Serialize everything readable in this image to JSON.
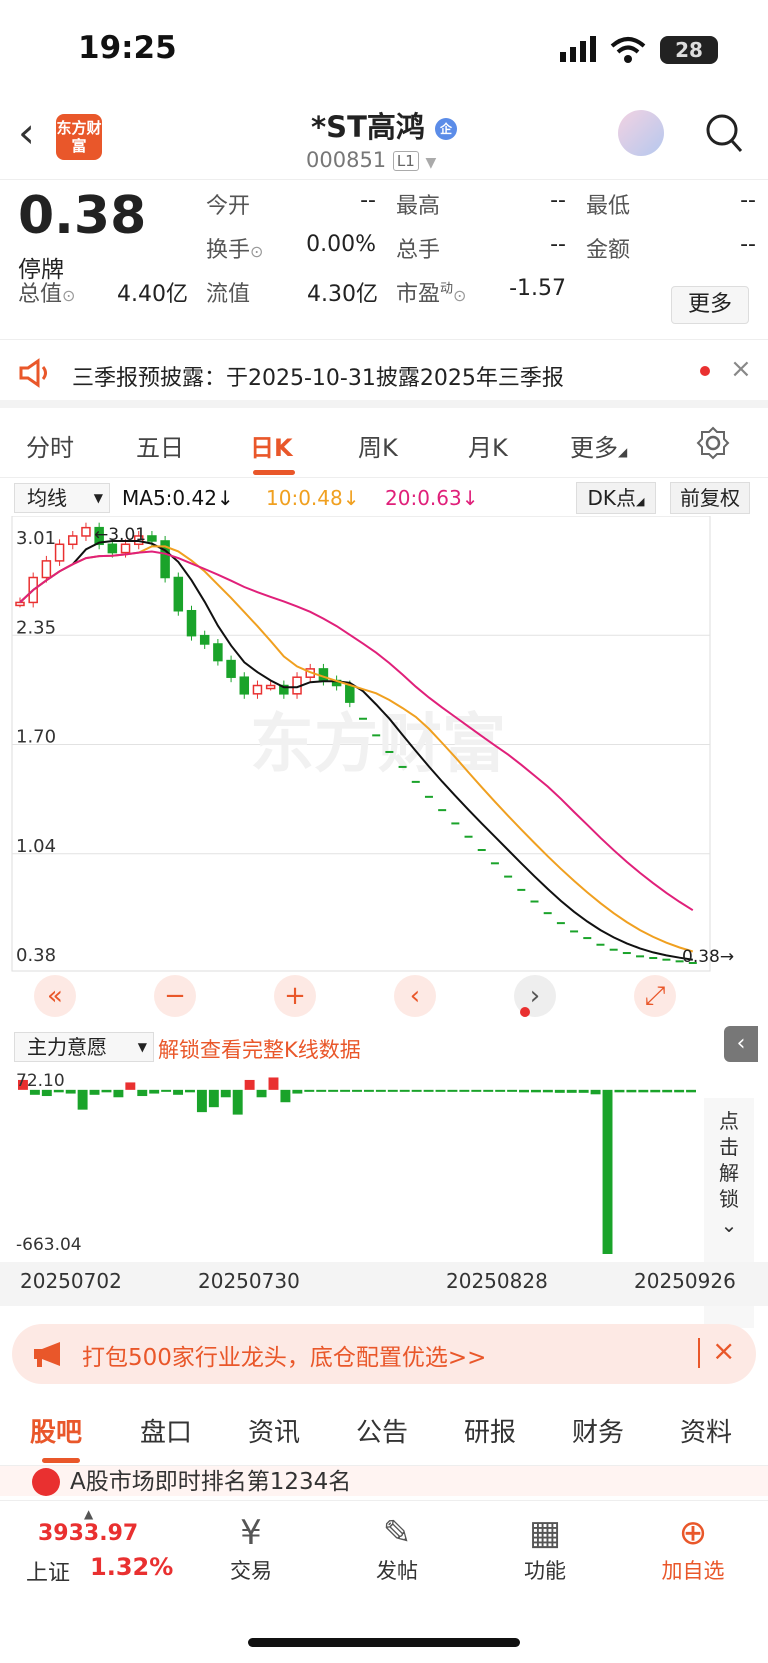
{
  "status": {
    "time": "19:25",
    "battery": "28"
  },
  "header": {
    "back_icon": "chevron-left-icon",
    "logo": "东方财富",
    "title": "*ST高鸿",
    "badge": "企",
    "code": "000851",
    "level": "L1"
  },
  "quote": {
    "price": "0.38",
    "state": "停牌",
    "labels": {
      "open": "今开",
      "high": "最高",
      "low": "最低",
      "turnover_rate": "换手",
      "total_hand": "总手",
      "amount": "金额",
      "total_value": "总值",
      "float_value": "流值",
      "pe": "市盈"
    },
    "pe_sup": "动",
    "values": {
      "open": "--",
      "high": "--",
      "low": "--",
      "turnover_rate": "0.00%",
      "total_hand": "--",
      "amount": "--",
      "total_value": "4.40亿",
      "float_value": "4.30亿",
      "pe": "-1.57"
    },
    "more": "更多"
  },
  "notice": {
    "text": "三季报预披露：于2025-10-31披露2025年三季报"
  },
  "tabs": [
    "分时",
    "五日",
    "日K",
    "周K",
    "月K",
    "更多"
  ],
  "chart": {
    "ind": "均线",
    "ma5": "MA5:0.42↓",
    "ma10": "10:0.48↓",
    "ma20": "20:0.63↓",
    "dk": "DK点",
    "fq": "前复权",
    "ylabels": [
      "3.01",
      "2.35",
      "1.70",
      "1.04",
      "0.38"
    ],
    "high_mark": "←3.01",
    "last_mark": "0.38→",
    "watermark": "东方财富",
    "colors": {
      "ma5": "#111111",
      "ma10": "#f0a020",
      "ma20": "#e0207a",
      "up": "#e93030",
      "down": "#1aa32a"
    }
  },
  "chart_data": {
    "type": "candlestick",
    "ylim": [
      0.38,
      3.01
    ],
    "ma": {
      "MA5": 0.42,
      "MA10": 0.48,
      "MA20": 0.63
    },
    "close": [
      2.55,
      2.7,
      2.8,
      2.9,
      2.95,
      3.0,
      2.9,
      2.85,
      2.9,
      2.95,
      2.92,
      2.7,
      2.5,
      2.35,
      2.3,
      2.2,
      2.1,
      2.0,
      2.05,
      2.05,
      2.0,
      2.1,
      2.15,
      2.08,
      2.05,
      1.95,
      1.85,
      1.75,
      1.65,
      1.56,
      1.47,
      1.38,
      1.3,
      1.22,
      1.14,
      1.06,
      0.98,
      0.9,
      0.82,
      0.75,
      0.68,
      0.62,
      0.57,
      0.53,
      0.49,
      0.46,
      0.44,
      0.42,
      0.41,
      0.4,
      0.39,
      0.38
    ]
  },
  "indicator": {
    "name": "主力意愿",
    "unlock": "解锁查看完整K线数据",
    "max": "72.10",
    "min": "-663.04",
    "side_unlock": [
      "点",
      "击",
      "解",
      "锁",
      "⌄"
    ]
  },
  "indicator_data": {
    "values": [
      40,
      -20,
      -25,
      -10,
      -15,
      -80,
      -20,
      -10,
      -30,
      30,
      -25,
      -15,
      -5,
      -20,
      -10,
      -90,
      -70,
      -30,
      -100,
      40,
      -30,
      50,
      -50,
      -15,
      -5,
      -5,
      -4,
      -4,
      -4,
      -4,
      -4,
      -5,
      -5,
      -6,
      -6,
      -6,
      -6,
      -8,
      -8,
      -8,
      -8,
      -8,
      -10,
      -10,
      -10,
      -12,
      -12,
      -12,
      -18,
      -663,
      -10,
      -10,
      -10,
      -10,
      -10,
      -10,
      -10
    ]
  },
  "dates": [
    "20250702",
    "20250730",
    "20250828",
    "20250926"
  ],
  "ad": {
    "text": "打包500家行业龙头，底仓配置优选>>"
  },
  "bottom_tabs": [
    "股吧",
    "盘口",
    "资讯",
    "公告",
    "研报",
    "财务",
    "资料"
  ],
  "peek": {
    "text": "A股市场即时排名第1234名"
  },
  "dock": {
    "index_value": "3933.97",
    "index_name": "上证",
    "index_pct": "1.32%",
    "items": [
      "交易",
      "发帖",
      "功能",
      "加自选"
    ]
  }
}
